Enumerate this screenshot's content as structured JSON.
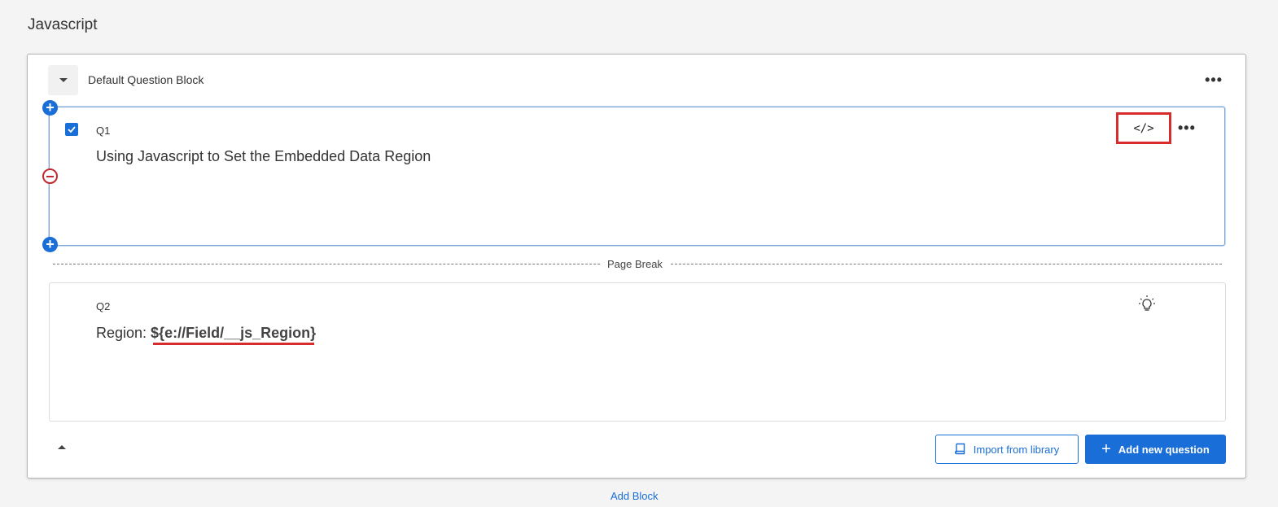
{
  "page": {
    "title": "Javascript"
  },
  "block": {
    "title": "Default Question Block",
    "more_icon": "ellipsis-icon",
    "more_label": "•••"
  },
  "q1": {
    "label": "Q1",
    "text": "Using Javascript to Set the Embedded Data Region",
    "checked": true,
    "js_icon": "</>",
    "more_label": "•••"
  },
  "page_break": {
    "label": "Page Break"
  },
  "q2": {
    "label": "Q2",
    "prefix": "Region: ",
    "token": "${e://Field/__js_Region}"
  },
  "footer": {
    "import_label": "Import from library",
    "add_question_label": "Add new question"
  },
  "add_block_label": "Add Block",
  "colors": {
    "accent": "#1a6ed8",
    "highlight": "#d82c2c",
    "remove": "#c0282e"
  }
}
